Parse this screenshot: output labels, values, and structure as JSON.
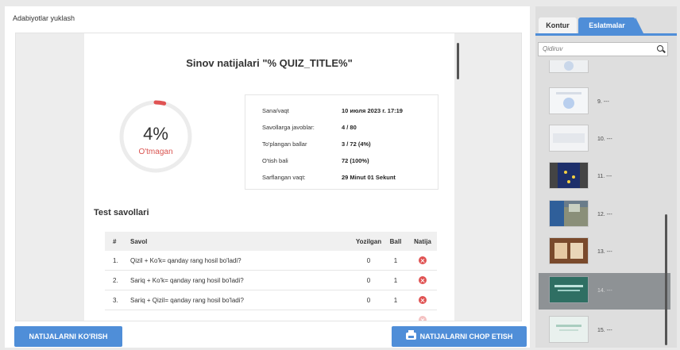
{
  "left_panel": {
    "title": "Adabiyotlar yuklash"
  },
  "quiz": {
    "title": "Sinov natijalari \"% QUIZ_TITLE%\"",
    "percent_label": "4%",
    "percent_value": 4,
    "status": "O'tmagan",
    "info": [
      {
        "label": "Sana/vaqt",
        "value": "10 июля 2023 г. 17:19"
      },
      {
        "label": "Savollarga javoblar:",
        "value": "4 / 80"
      },
      {
        "label": "To'plangan ballar",
        "value": "3 / 72 (4%)"
      },
      {
        "label": "O'tish bali",
        "value": "72 (100%)"
      },
      {
        "label": "Sarflangan vaqt:",
        "value": "29 Minut 01 Sekunt"
      }
    ],
    "questions_title": "Test savollari",
    "table_headers": {
      "num": "#",
      "question": "Savol",
      "written": "Yozilgan",
      "score": "Ball",
      "result": "Natija"
    },
    "rows": [
      {
        "num": "1.",
        "question": "Qizil + Ko'k= qanday rang hosil bo'ladi?",
        "written": "0",
        "score": "1",
        "result_icon": "fail-icon"
      },
      {
        "num": "2.",
        "question": "Sariq + Ko'k= qanday rang hosil bo'ladi?",
        "written": "0",
        "score": "1",
        "result_icon": "fail-icon"
      },
      {
        "num": "3.",
        "question": "Sariq + Qizil= qanday rang hosil bo'ladi?",
        "written": "0",
        "score": "1",
        "result_icon": "fail-icon"
      }
    ]
  },
  "buttons": {
    "view_results": "NATIJALARNI KO'RISH",
    "print_results": "NATIJALARNI CHOP ETISH"
  },
  "sidebar": {
    "tabs": [
      "Kontur",
      "Eslatmalar"
    ],
    "active_tab": "Eslatmalar",
    "search_placeholder": "Qidiruv",
    "slides": [
      {
        "label": "",
        "active": false
      },
      {
        "label": "9. ---",
        "active": false
      },
      {
        "label": "10. ---",
        "active": false
      },
      {
        "label": "11. ---",
        "active": false
      },
      {
        "label": "12. ---",
        "active": false
      },
      {
        "label": "13. ---",
        "active": false
      },
      {
        "label": "14. ---",
        "active": true
      },
      {
        "label": "15. ---",
        "active": false
      }
    ]
  },
  "colors": {
    "accent": "#4f8ed8",
    "fail": "#e05353",
    "gauge_track": "#ececec",
    "gauge_fill": "#e05353"
  }
}
